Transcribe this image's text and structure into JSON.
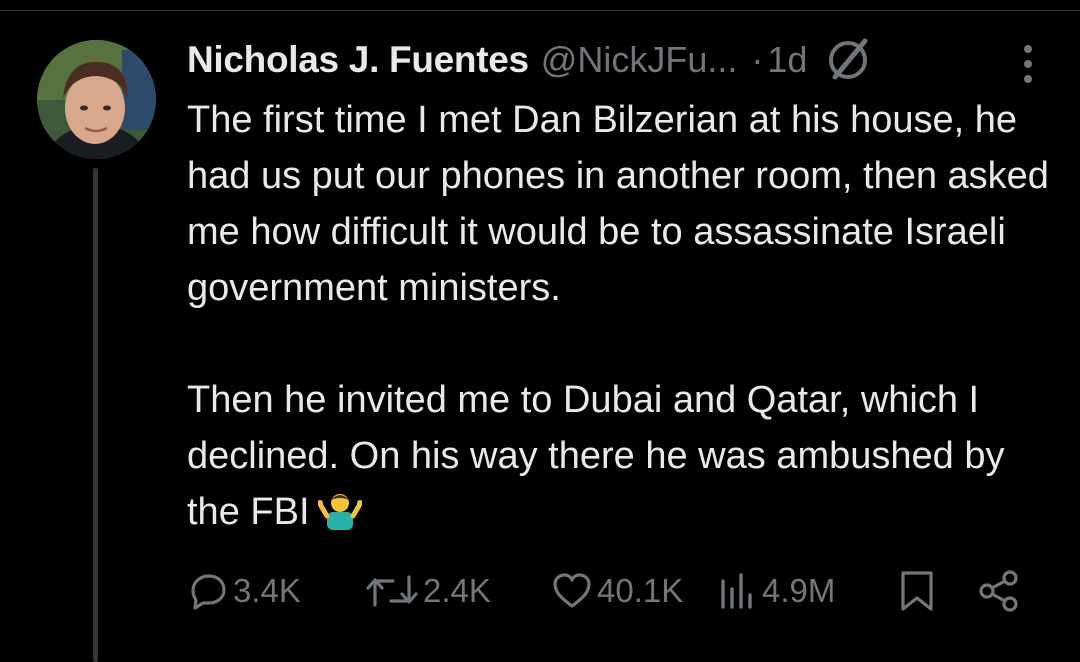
{
  "tweet": {
    "author_name": "Nicholas J. Fuentes",
    "handle": "@NickJFu...",
    "separator": "·",
    "time": "1d",
    "paragraphs": [
      "The first time I met Dan Bilzerian at his house, he had us put our phones in another room, then asked me how difficult it would be to assassinate Israeli government ministers.",
      "Then he invited me to Dubai and Qatar, which I declined. On his way there he was ambushed by the FBI"
    ],
    "emoji": "person-shrugging"
  },
  "actions": {
    "replies": "3.4K",
    "reposts": "2.4K",
    "likes": "40.1K",
    "views": "4.9M"
  },
  "colors": {
    "background": "#000000",
    "text": "#e7e9ea",
    "muted": "#71767b",
    "thread_line": "#333639"
  }
}
